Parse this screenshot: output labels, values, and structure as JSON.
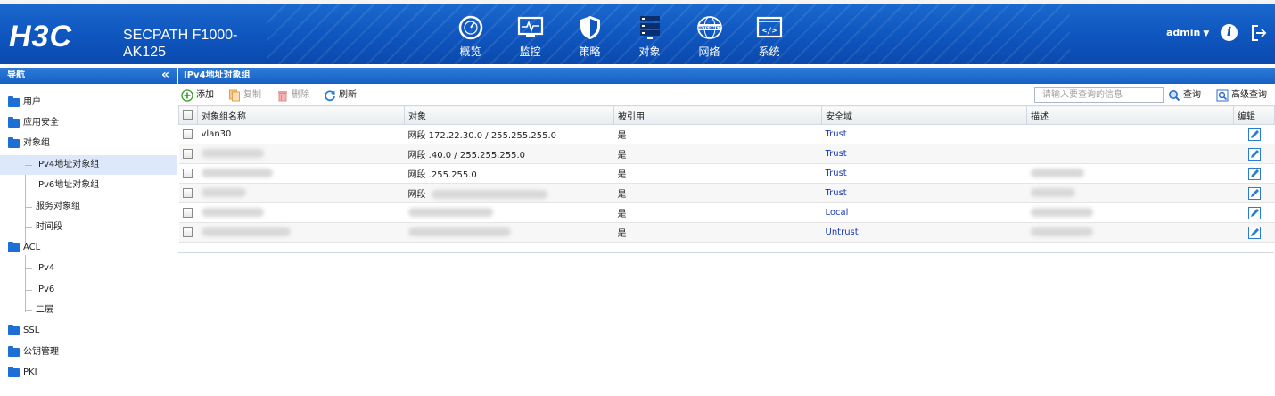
{
  "header": {
    "logo": "H3C",
    "product_line1": "SECPATH F1000-",
    "product_line2": "AK125",
    "user": "admin",
    "brand_color": "#0f56bf",
    "nav": [
      {
        "label": "概览",
        "icon": "dashboard-gauge-icon"
      },
      {
        "label": "监控",
        "icon": "monitor-icon"
      },
      {
        "label": "策略",
        "icon": "shield-icon"
      },
      {
        "label": "对象",
        "icon": "objects-list-icon"
      },
      {
        "label": "网络",
        "icon": "internet-globe-icon"
      },
      {
        "label": "系统",
        "icon": "code-window-icon"
      }
    ],
    "globe_text": "INTERNET"
  },
  "sidebar": {
    "title": "导航",
    "items": [
      {
        "label": "用户"
      },
      {
        "label": "应用安全"
      },
      {
        "label": "对象组"
      },
      {
        "label": "IPv4地址对象组"
      },
      {
        "label": "IPv6地址对象组"
      },
      {
        "label": "服务对象组"
      },
      {
        "label": "时间段"
      },
      {
        "label": "ACL"
      },
      {
        "label": "IPv4"
      },
      {
        "label": "IPv6"
      },
      {
        "label": "二层"
      },
      {
        "label": "SSL"
      },
      {
        "label": "公钥管理"
      },
      {
        "label": "PKI"
      }
    ]
  },
  "panel": {
    "title": "IPv4地址对象组",
    "toolbar": {
      "add": "添加",
      "copy": "复制",
      "delete": "删除",
      "refresh": "刷新",
      "search_placeholder": "请输入要查询的信息",
      "query": "查询",
      "advanced_query": "高级查询"
    },
    "columns": [
      "对象组名称",
      "对象",
      "被引用",
      "安全域",
      "描述",
      "编辑"
    ],
    "rows": [
      {
        "name": "vlan30",
        "object": "网段 172.22.30.0 / 255.255.255.0",
        "referenced": "是",
        "zone": "Trust",
        "desc": ""
      },
      {
        "name": "",
        "object": "网段 .40.0 / 255.255.255.0",
        "referenced": "是",
        "zone": "Trust",
        "desc": ""
      },
      {
        "name": "",
        "object": "网段 .255.255.0",
        "referenced": "是",
        "zone": "Trust",
        "desc": ""
      },
      {
        "name": "",
        "object": "网段",
        "referenced": "是",
        "zone": "Trust",
        "desc": ""
      },
      {
        "name": "",
        "object": "",
        "referenced": "是",
        "zone": "Local",
        "desc": ""
      },
      {
        "name": "",
        "object": "",
        "referenced": "是",
        "zone": "Untrust",
        "desc": ""
      }
    ]
  }
}
